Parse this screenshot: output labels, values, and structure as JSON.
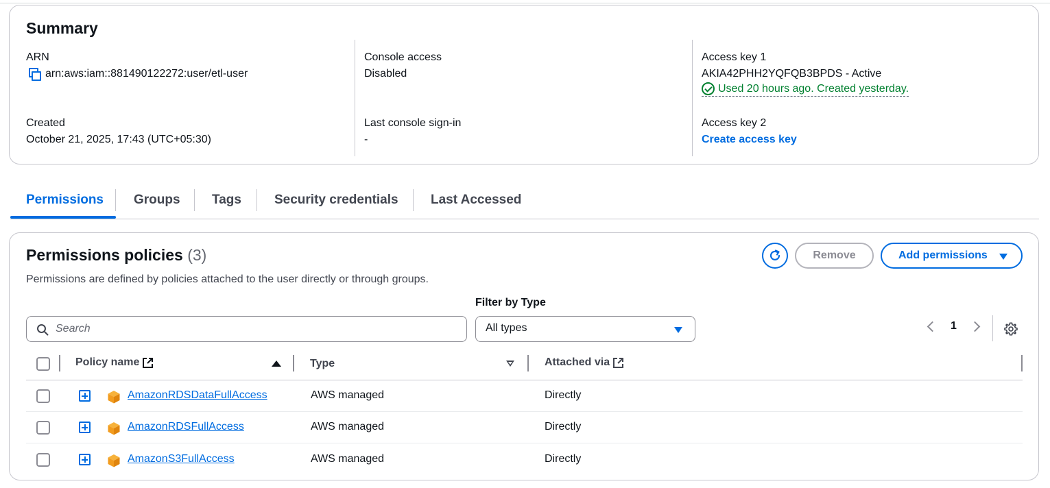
{
  "summary": {
    "title": "Summary",
    "arn_label": "ARN",
    "arn_value": "arn:aws:iam::881490122272:user/etl-user",
    "created_label": "Created",
    "created_value": "October 21, 2025, 17:43 (UTC+05:30)",
    "console_access_label": "Console access",
    "console_access_value": "Disabled",
    "last_signin_label": "Last console sign-in",
    "last_signin_value": "-",
    "access_key1_label": "Access key 1",
    "access_key1_value": "AKIA42PHH2YQFQB3BPDS - Active",
    "access_key1_status": "Used 20 hours ago. Created yesterday.",
    "access_key2_label": "Access key 2",
    "create_access_key": "Create access key"
  },
  "tabs": [
    {
      "label": "Permissions",
      "active": true
    },
    {
      "label": "Groups"
    },
    {
      "label": "Tags"
    },
    {
      "label": "Security credentials"
    },
    {
      "label": "Last Accessed"
    }
  ],
  "permissions": {
    "title": "Permissions policies",
    "count": "(3)",
    "description": "Permissions are defined by policies attached to the user directly or through groups.",
    "remove_label": "Remove",
    "add_label": "Add permissions",
    "filter_label": "Filter by Type",
    "filter_value": "All types",
    "search_placeholder": "Search",
    "page": "1",
    "columns": {
      "policy_name": "Policy name",
      "type": "Type",
      "attached_via": "Attached via"
    },
    "rows": [
      {
        "name": "AmazonRDSDataFullAccess",
        "type": "AWS managed",
        "via": "Directly"
      },
      {
        "name": "AmazonRDSFullAccess",
        "type": "AWS managed",
        "via": "Directly"
      },
      {
        "name": "AmazonS3FullAccess",
        "type": "AWS managed",
        "via": "Directly"
      }
    ]
  },
  "colors": {
    "accent": "#006ce0",
    "success": "#00802f",
    "policy_icon": "#f29c1f"
  }
}
